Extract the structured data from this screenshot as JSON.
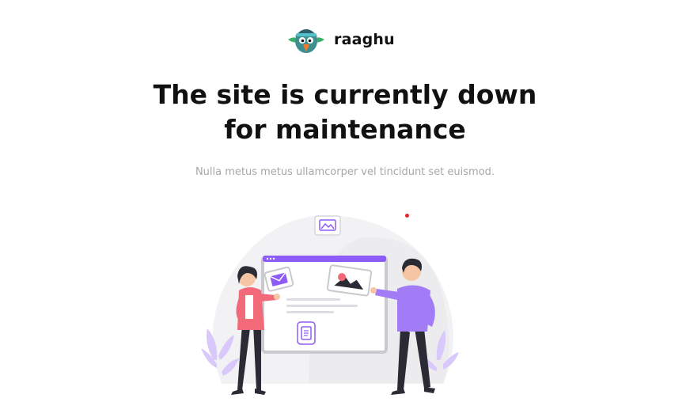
{
  "brand": {
    "name": "raaghu"
  },
  "maintenance": {
    "title_line1": "The site is currently down",
    "title_line2": "for maintenance",
    "description": "Nulla metus metus ullamcorper vel tincidunt set euismod."
  },
  "colors": {
    "accent": "#8d5cf6",
    "blob": "#f2f2f4",
    "coral": "#f26a7a",
    "dark": "#2b2b36",
    "dot": "#e02a2a"
  },
  "icons": {
    "image_badge": "image-icon",
    "mail_card": "mail-icon",
    "document_card": "document-icon"
  }
}
